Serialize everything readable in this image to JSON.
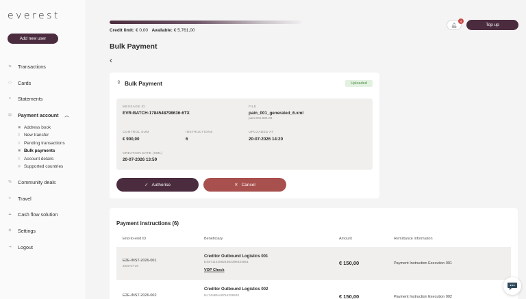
{
  "sidebar": {
    "logo": "everest",
    "add_user_label": "Add new user",
    "items": [
      {
        "label": "Transactions",
        "icon": "transfer-icon"
      },
      {
        "label": "Cards",
        "icon": "card-icon"
      },
      {
        "label": "Statements",
        "icon": "list-icon"
      },
      {
        "label": "Payment account",
        "icon": "account-icon",
        "active": true,
        "expanded": true
      },
      {
        "label": "Community deals",
        "icon": "percent-icon"
      },
      {
        "label": "Travel",
        "icon": "plane-icon"
      },
      {
        "label": "Cash flow solution",
        "icon": "cashflow-icon"
      },
      {
        "label": "Settings",
        "icon": "gear-icon"
      },
      {
        "label": "Logout",
        "icon": "logout-icon"
      }
    ],
    "sub_items": [
      {
        "label": "Address book"
      },
      {
        "label": "New transfer"
      },
      {
        "label": "Pending transactions"
      },
      {
        "label": "Bulk payments",
        "active": true
      },
      {
        "label": "Account details"
      },
      {
        "label": "Supported countries"
      }
    ]
  },
  "header": {
    "credit_limit_label": "Credit limit:",
    "credit_limit_value": "€ 0,00",
    "available_label": "Available:",
    "available_value": "€ 5.761,00",
    "notification_count": "4",
    "topup_label": "Top up"
  },
  "page": {
    "title": "Bulk Payment"
  },
  "card": {
    "title": "Bulk Payment",
    "status": "Uploaded",
    "message_id_label": "MESSAGE ID",
    "message_id": "EVR-BATCH-1784548798636-6TX",
    "file_label": "FILE",
    "file_name": "pain_001_generated_6.xml",
    "file_type": "pain.001.001.03",
    "control_sum_label": "CONTROL SUM",
    "control_sum": "€ 900,00",
    "instructions_label": "INSTRUCTIONS",
    "instructions": "6",
    "uploaded_at_label": "UPLOADED AT",
    "uploaded_at": "20-07-2026 14:20",
    "creation_date_label": "CREATION DATE (XML)",
    "creation_date": "20-07-2026 13:59",
    "authorise_label": "Authorise",
    "cancel_label": "Cancel"
  },
  "instructions_table": {
    "title": "Payment instructions (6)",
    "columns": [
      "End-to-end ID",
      "Beneficiary",
      "Amount",
      "Remittance information"
    ],
    "rows": [
      {
        "e2e": "E2E-INST-2026-001",
        "date": "2026-07-20",
        "name": "Creditor Outbound Logistics 001",
        "iban": "ES8711425624383398434851",
        "vop": "VOP Check",
        "amount": "€ 150,00",
        "remittance": "Payment Instruction Execution 001"
      },
      {
        "e2e": "E2E-INST-2026-002",
        "date": "",
        "name": "Creditor Outbound Logistics 002",
        "iban": "NL74ABNA8764329532",
        "vop": "",
        "amount": "€ 150,00",
        "remittance": "Payment Instruction Execution 002"
      }
    ]
  },
  "colors": {
    "brand": "#4b2c3f",
    "cancel": "#a8504e",
    "uploaded_bg": "#e3f1e1",
    "uploaded_text": "#4a8a44"
  }
}
